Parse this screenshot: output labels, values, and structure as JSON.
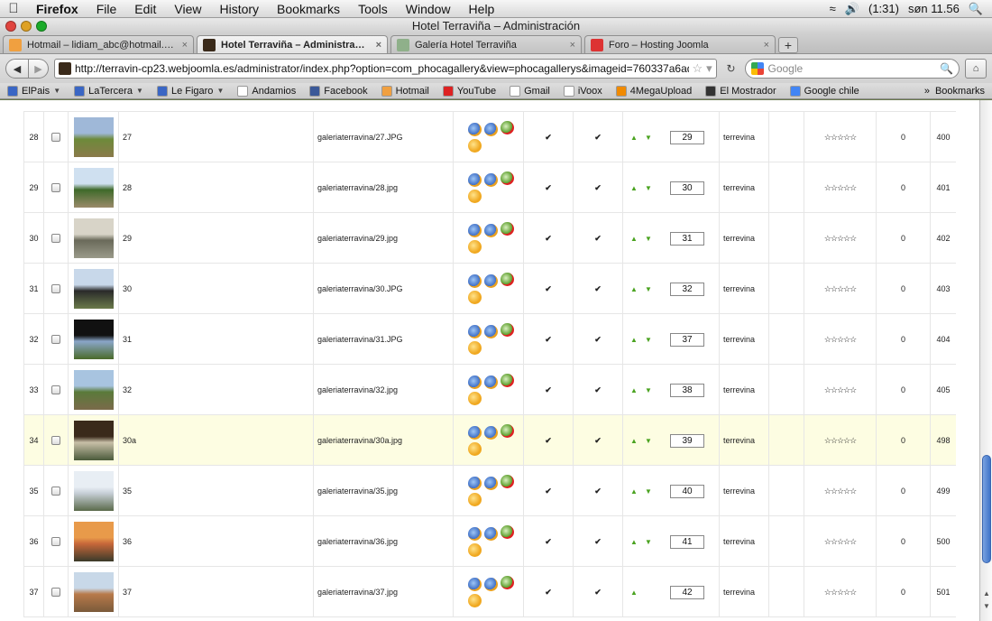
{
  "menubar": {
    "apple_icon": "apple-logo",
    "items": [
      "Firefox",
      "File",
      "Edit",
      "View",
      "History",
      "Bookmarks",
      "Tools",
      "Window",
      "Help"
    ],
    "clock": "søn 11.56",
    "battery": "(1:31)"
  },
  "window": {
    "title": "Hotel Terraviña – Administración"
  },
  "tabs": [
    {
      "label": "Hotmail – lidiam_abc@hotmail.c...",
      "icon_color": "#f0a040",
      "active": false
    },
    {
      "label": "Hotel Terraviña – Administración",
      "icon_color": "#3a2a1a",
      "active": true
    },
    {
      "label": "Galería Hotel Terraviña",
      "icon_color": "#8fb08a",
      "active": false
    },
    {
      "label": "Foro – Hosting Joomla",
      "icon_color": "#d33",
      "active": false
    }
  ],
  "nav": {
    "url": "http://terravin-cp23.webjoomla.es/administrator/index.php?option=com_phocagallery&view=phocagallerys&imageid=760337a6ad4",
    "search_placeholder": "Google"
  },
  "bookmarks": [
    {
      "label": "ElPais",
      "icon_color": "#3a66c4",
      "dropdown": true
    },
    {
      "label": "LaTercera",
      "icon_color": "#3a66c4",
      "dropdown": true
    },
    {
      "label": "Le Figaro",
      "icon_color": "#3a66c4",
      "dropdown": true
    },
    {
      "label": "Andamios",
      "icon_color": "#ffffff",
      "dropdown": false
    },
    {
      "label": "Facebook",
      "icon_color": "#3b5998",
      "dropdown": false
    },
    {
      "label": "Hotmail",
      "icon_color": "#f0a040",
      "dropdown": false
    },
    {
      "label": "YouTube",
      "icon_color": "#d22",
      "dropdown": false
    },
    {
      "label": "Gmail",
      "icon_color": "#ffffff",
      "dropdown": false
    },
    {
      "label": "iVoox",
      "icon_color": "#ffffff",
      "dropdown": false
    },
    {
      "label": "4MegaUpload",
      "icon_color": "#f08a00",
      "dropdown": false
    },
    {
      "label": "El Mostrador",
      "icon_color": "#333333",
      "dropdown": false
    },
    {
      "label": "Google chile",
      "icon_color": "#4285f4",
      "dropdown": false
    }
  ],
  "bookmarks_more": "»",
  "bookmarks_menu": "Bookmarks",
  "rows": [
    {
      "num": "28",
      "title": "27",
      "file": "galeriaterravina/27.JPG",
      "order": "29",
      "author": "terrevina",
      "hits": "0",
      "id": "400",
      "thumb_colors": [
        "#9fb8d8",
        "#6d8a3a",
        "#8a7a4a"
      ],
      "order_down": true,
      "highlight": false
    },
    {
      "num": "29",
      "title": "28",
      "file": "galeriaterravina/28.jpg",
      "order": "30",
      "author": "terrevina",
      "hits": "0",
      "id": "401",
      "thumb_colors": [
        "#cfe0f0",
        "#3e6a2a",
        "#9a8a6a"
      ],
      "order_down": true,
      "highlight": false
    },
    {
      "num": "30",
      "title": "29",
      "file": "galeriaterravina/29.jpg",
      "order": "31",
      "author": "terrevina",
      "hits": "0",
      "id": "402",
      "thumb_colors": [
        "#d8d4c8",
        "#6a6a5a",
        "#9a9a8a"
      ],
      "order_down": true,
      "highlight": false
    },
    {
      "num": "31",
      "title": "30",
      "file": "galeriaterravina/30.JPG",
      "order": "32",
      "author": "terrevina",
      "hits": "0",
      "id": "403",
      "thumb_colors": [
        "#c8d8ea",
        "#2a2a2a",
        "#6a7a4a"
      ],
      "order_down": true,
      "highlight": false
    },
    {
      "num": "32",
      "title": "31",
      "file": "galeriaterravina/31.JPG",
      "order": "37",
      "author": "terrevina",
      "hits": "0",
      "id": "404",
      "thumb_colors": [
        "#111111",
        "#8aa6c8",
        "#4a6a2a"
      ],
      "order_down": true,
      "highlight": false
    },
    {
      "num": "33",
      "title": "32",
      "file": "galeriaterravina/32.jpg",
      "order": "38",
      "author": "terrevina",
      "hits": "0",
      "id": "405",
      "thumb_colors": [
        "#a8c4e0",
        "#5a7a3a",
        "#7a6a4a"
      ],
      "order_down": true,
      "highlight": false
    },
    {
      "num": "34",
      "title": "30a",
      "file": "galeriaterravina/30a.jpg",
      "order": "39",
      "author": "terrevina",
      "hits": "0",
      "id": "498",
      "thumb_colors": [
        "#3a2a1a",
        "#c8c0a8",
        "#4a5a3a"
      ],
      "order_down": true,
      "highlight": true
    },
    {
      "num": "35",
      "title": "35",
      "file": "galeriaterravina/35.jpg",
      "order": "40",
      "author": "terrevina",
      "hits": "0",
      "id": "499",
      "thumb_colors": [
        "#e8eef4",
        "#c8d0d8",
        "#5a6a4a"
      ],
      "order_down": true,
      "highlight": false
    },
    {
      "num": "36",
      "title": "36",
      "file": "galeriaterravina/36.jpg",
      "order": "41",
      "author": "terrevina",
      "hits": "0",
      "id": "500",
      "thumb_colors": [
        "#e89a4a",
        "#c8683a",
        "#3a3a2a"
      ],
      "order_down": true,
      "highlight": false
    },
    {
      "num": "37",
      "title": "37",
      "file": "galeriaterravina/37.jpg",
      "order": "42",
      "author": "terrevina",
      "hits": "0",
      "id": "501",
      "thumb_colors": [
        "#c8d8e8",
        "#b87a4a",
        "#7a5a3a"
      ],
      "order_down": false,
      "highlight": false
    }
  ],
  "icons": {
    "published": "check-icon",
    "approved": "check-icon",
    "order_up": "arrow-up-icon",
    "order_down": "arrow-down-icon",
    "rating": "star-icon",
    "actions": [
      "view-icon",
      "edit-icon",
      "approve-icon",
      "rotate-icon"
    ]
  },
  "colors": {
    "link": "#2255aa",
    "check": "#4aa320",
    "highlight_row": "#fdfde2"
  }
}
